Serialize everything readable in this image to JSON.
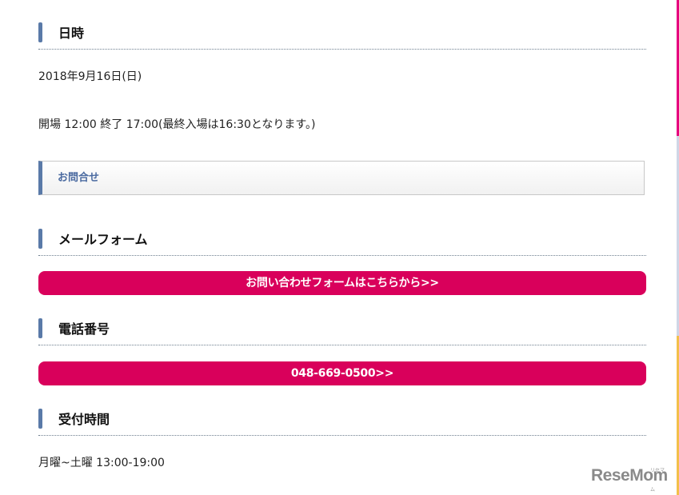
{
  "datetime": {
    "heading": "日時",
    "date": "2018年9月16日(日)",
    "hours": "開場 12:00 終了 17:00(最終入場は16:30となります。)"
  },
  "contact": {
    "box_label": "お問合せ"
  },
  "mail_form": {
    "heading": "メールフォーム",
    "button_label": "お問い合わせフォームはこちらから>>"
  },
  "phone": {
    "heading": "電話番号",
    "button_label": "048-669-0500>>"
  },
  "reception": {
    "heading": "受付時間",
    "hours": "月曜~土曜 13:00-19:00"
  },
  "watermark": {
    "logo": "ReseMom",
    "sub": "リセマム"
  },
  "colors": {
    "accent_bar": "#5a7aa8",
    "button_pink": "#d9005b",
    "box_label": "#4a6aa0"
  }
}
